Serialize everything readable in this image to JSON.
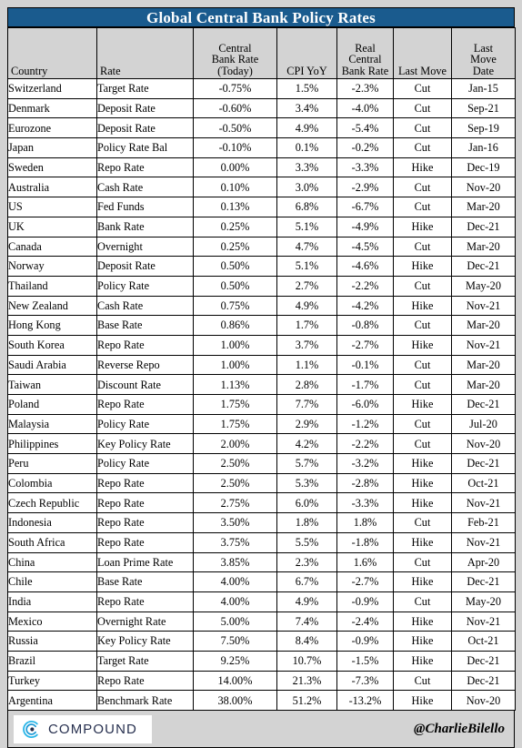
{
  "title": "Global Central Bank Policy Rates",
  "colors": {
    "title_bar": "#1a5b8e",
    "sheet_bg": "#d3d3d3",
    "negative_bg": "#ffc7ce",
    "negative_text": "#9c0006",
    "positive_bg": "#c6efce",
    "positive_text": "#006100",
    "cut_bg": "#00a14b",
    "hike_bg": "#f4564b",
    "highlight_bg": "#00aeef"
  },
  "columns": [
    {
      "key": "country",
      "label": "Country",
      "align": "left"
    },
    {
      "key": "rate",
      "label": "Rate",
      "align": "left"
    },
    {
      "key": "cbr",
      "label": "Central Bank Rate (Today)",
      "lines": [
        "Central",
        "Bank Rate",
        "(Today)"
      ],
      "align": "center"
    },
    {
      "key": "cpi",
      "label": "CPI YoY",
      "lines": [
        "CPI YoY"
      ],
      "align": "center"
    },
    {
      "key": "real",
      "label": "Real Central Bank Rate",
      "lines": [
        "Real",
        "Central",
        "Bank Rate"
      ],
      "align": "center"
    },
    {
      "key": "move",
      "label": "Last Move",
      "lines": [
        "Last Move"
      ],
      "align": "center"
    },
    {
      "key": "date",
      "label": "Last Move Date",
      "lines": [
        "Last",
        "Move",
        "Date"
      ],
      "align": "center"
    }
  ],
  "rows": [
    {
      "country": "Switzerland",
      "rate": "Target Rate",
      "cbr": "-0.75%",
      "cbr_state": "neg",
      "cpi": "1.5%",
      "real": "-2.3%",
      "real_state": "neg",
      "move": "Cut",
      "date": "Jan-15",
      "highlight": false
    },
    {
      "country": "Denmark",
      "rate": "Deposit Rate",
      "cbr": "-0.60%",
      "cbr_state": "neg",
      "cpi": "3.4%",
      "real": "-4.0%",
      "real_state": "neg",
      "move": "Cut",
      "date": "Sep-21",
      "highlight": false
    },
    {
      "country": "Eurozone",
      "rate": "Deposit Rate",
      "cbr": "-0.50%",
      "cbr_state": "neg",
      "cpi": "4.9%",
      "real": "-5.4%",
      "real_state": "neg",
      "move": "Cut",
      "date": "Sep-19",
      "highlight": false
    },
    {
      "country": "Japan",
      "rate": "Policy Rate Bal",
      "cbr": "-0.10%",
      "cbr_state": "neg",
      "cpi": "0.1%",
      "real": "-0.2%",
      "real_state": "neg",
      "move": "Cut",
      "date": "Jan-16",
      "highlight": false
    },
    {
      "country": "Sweden",
      "rate": "Repo Rate",
      "cbr": "0.00%",
      "cbr_state": "plain",
      "cpi": "3.3%",
      "real": "-3.3%",
      "real_state": "neg",
      "move": "Hike",
      "date": "Dec-19",
      "highlight": false
    },
    {
      "country": "Australia",
      "rate": "Cash Rate",
      "cbr": "0.10%",
      "cbr_state": "plain",
      "cpi": "3.0%",
      "real": "-2.9%",
      "real_state": "neg",
      "move": "Cut",
      "date": "Nov-20",
      "highlight": false
    },
    {
      "country": "US",
      "rate": "Fed Funds",
      "cbr": "0.13%",
      "cbr_state": "plain",
      "cpi": "6.8%",
      "real": "-6.7%",
      "real_state": "neg",
      "move": "Cut",
      "date": "Mar-20",
      "highlight": false
    },
    {
      "country": "UK",
      "rate": "Bank Rate",
      "cbr": "0.25%",
      "cbr_state": "plain",
      "cpi": "5.1%",
      "real": "-4.9%",
      "real_state": "neg",
      "move": "Hike",
      "date": "Dec-21",
      "highlight": true
    },
    {
      "country": "Canada",
      "rate": "Overnight",
      "cbr": "0.25%",
      "cbr_state": "plain",
      "cpi": "4.7%",
      "real": "-4.5%",
      "real_state": "neg",
      "move": "Cut",
      "date": "Mar-20",
      "highlight": false
    },
    {
      "country": "Norway",
      "rate": "Deposit Rate",
      "cbr": "0.50%",
      "cbr_state": "plain",
      "cpi": "5.1%",
      "real": "-4.6%",
      "real_state": "neg",
      "move": "Hike",
      "date": "Dec-21",
      "highlight": true
    },
    {
      "country": "Thailand",
      "rate": "Policy Rate",
      "cbr": "0.50%",
      "cbr_state": "plain",
      "cpi": "2.7%",
      "real": "-2.2%",
      "real_state": "neg",
      "move": "Cut",
      "date": "May-20",
      "highlight": false
    },
    {
      "country": "New Zealand",
      "rate": "Cash Rate",
      "cbr": "0.75%",
      "cbr_state": "plain",
      "cpi": "4.9%",
      "real": "-4.2%",
      "real_state": "neg",
      "move": "Hike",
      "date": "Nov-21",
      "highlight": false
    },
    {
      "country": "Hong Kong",
      "rate": "Base Rate",
      "cbr": "0.86%",
      "cbr_state": "plain",
      "cpi": "1.7%",
      "real": "-0.8%",
      "real_state": "neg",
      "move": "Cut",
      "date": "Mar-20",
      "highlight": false
    },
    {
      "country": "South Korea",
      "rate": "Repo Rate",
      "cbr": "1.00%",
      "cbr_state": "plain",
      "cpi": "3.7%",
      "real": "-2.7%",
      "real_state": "neg",
      "move": "Hike",
      "date": "Nov-21",
      "highlight": false
    },
    {
      "country": "Saudi Arabia",
      "rate": "Reverse Repo",
      "cbr": "1.00%",
      "cbr_state": "plain",
      "cpi": "1.1%",
      "real": "-0.1%",
      "real_state": "neg",
      "move": "Cut",
      "date": "Mar-20",
      "highlight": false
    },
    {
      "country": "Taiwan",
      "rate": "Discount Rate",
      "cbr": "1.13%",
      "cbr_state": "plain",
      "cpi": "2.8%",
      "real": "-1.7%",
      "real_state": "neg",
      "move": "Cut",
      "date": "Mar-20",
      "highlight": false
    },
    {
      "country": "Poland",
      "rate": "Repo Rate",
      "cbr": "1.75%",
      "cbr_state": "plain",
      "cpi": "7.7%",
      "real": "-6.0%",
      "real_state": "neg",
      "move": "Hike",
      "date": "Dec-21",
      "highlight": false
    },
    {
      "country": "Malaysia",
      "rate": "Policy Rate",
      "cbr": "1.75%",
      "cbr_state": "plain",
      "cpi": "2.9%",
      "real": "-1.2%",
      "real_state": "neg",
      "move": "Cut",
      "date": "Jul-20",
      "highlight": false
    },
    {
      "country": "Philippines",
      "rate": "Key Policy Rate",
      "cbr": "2.00%",
      "cbr_state": "plain",
      "cpi": "4.2%",
      "real": "-2.2%",
      "real_state": "neg",
      "move": "Cut",
      "date": "Nov-20",
      "highlight": false
    },
    {
      "country": "Peru",
      "rate": "Policy Rate",
      "cbr": "2.50%",
      "cbr_state": "plain",
      "cpi": "5.7%",
      "real": "-3.2%",
      "real_state": "neg",
      "move": "Hike",
      "date": "Dec-21",
      "highlight": false
    },
    {
      "country": "Colombia",
      "rate": "Repo Rate",
      "cbr": "2.50%",
      "cbr_state": "plain",
      "cpi": "5.3%",
      "real": "-2.8%",
      "real_state": "neg",
      "move": "Hike",
      "date": "Oct-21",
      "highlight": false
    },
    {
      "country": "Czech Republic",
      "rate": "Repo Rate",
      "cbr": "2.75%",
      "cbr_state": "plain",
      "cpi": "6.0%",
      "real": "-3.3%",
      "real_state": "neg",
      "move": "Hike",
      "date": "Nov-21",
      "highlight": false
    },
    {
      "country": "Indonesia",
      "rate": "Repo Rate",
      "cbr": "3.50%",
      "cbr_state": "plain",
      "cpi": "1.8%",
      "real": "1.8%",
      "real_state": "pos",
      "move": "Cut",
      "date": "Feb-21",
      "highlight": false
    },
    {
      "country": "South Africa",
      "rate": "Repo Rate",
      "cbr": "3.75%",
      "cbr_state": "plain",
      "cpi": "5.5%",
      "real": "-1.8%",
      "real_state": "neg",
      "move": "Hike",
      "date": "Nov-21",
      "highlight": false
    },
    {
      "country": "China",
      "rate": "Loan Prime Rate",
      "cbr": "3.85%",
      "cbr_state": "plain",
      "cpi": "2.3%",
      "real": "1.6%",
      "real_state": "pos",
      "move": "Cut",
      "date": "Apr-20",
      "highlight": false
    },
    {
      "country": "Chile",
      "rate": "Base Rate",
      "cbr": "4.00%",
      "cbr_state": "plain",
      "cpi": "6.7%",
      "real": "-2.7%",
      "real_state": "neg",
      "move": "Hike",
      "date": "Dec-21",
      "highlight": true
    },
    {
      "country": "India",
      "rate": "Repo Rate",
      "cbr": "4.00%",
      "cbr_state": "plain",
      "cpi": "4.9%",
      "real": "-0.9%",
      "real_state": "neg",
      "move": "Cut",
      "date": "May-20",
      "highlight": false
    },
    {
      "country": "Mexico",
      "rate": "Overnight Rate",
      "cbr": "5.00%",
      "cbr_state": "plain",
      "cpi": "7.4%",
      "real": "-2.4%",
      "real_state": "neg",
      "move": "Hike",
      "date": "Nov-21",
      "highlight": false
    },
    {
      "country": "Russia",
      "rate": "Key Policy Rate",
      "cbr": "7.50%",
      "cbr_state": "plain",
      "cpi": "8.4%",
      "real": "-0.9%",
      "real_state": "neg",
      "move": "Hike",
      "date": "Oct-21",
      "highlight": false
    },
    {
      "country": "Brazil",
      "rate": "Target Rate",
      "cbr": "9.25%",
      "cbr_state": "plain",
      "cpi": "10.7%",
      "real": "-1.5%",
      "real_state": "neg",
      "move": "Hike",
      "date": "Dec-21",
      "highlight": false
    },
    {
      "country": "Turkey",
      "rate": "Repo Rate",
      "cbr": "14.00%",
      "cbr_state": "plain",
      "cpi": "21.3%",
      "real": "-7.3%",
      "real_state": "neg",
      "move": "Cut",
      "date": "Dec-21",
      "highlight": true
    },
    {
      "country": "Argentina",
      "rate": "Benchmark Rate",
      "cbr": "38.00%",
      "cbr_state": "plain",
      "cpi": "51.2%",
      "real": "-13.2%",
      "real_state": "neg",
      "move": "Hike",
      "date": "Nov-20",
      "highlight": false
    }
  ],
  "footer": {
    "brand": "COMPOUND",
    "handle": "@CharlieBilello"
  }
}
